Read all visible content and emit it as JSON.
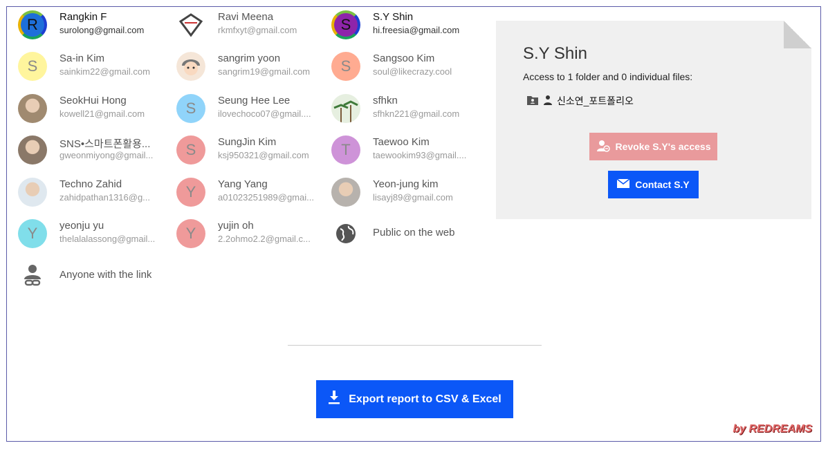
{
  "people": [
    {
      "name": "Rangkin F",
      "email": "surolong@gmail.com",
      "initial": "R",
      "avatar_bg": "#1e6fd9",
      "avatar_fg": "#111",
      "selected": true,
      "col": 0,
      "row": 0
    },
    {
      "name": "Ravi Meena",
      "email": "rkmfxyt@gmail.com",
      "initial": "",
      "avatar_bg": "#ffffff",
      "selected": false,
      "col": 1,
      "row": 0,
      "icon": "ravi-logo-icon"
    },
    {
      "name": "S.Y Shin",
      "email": "hi.freesia@gmail.com",
      "initial": "S",
      "avatar_bg": "#8e24aa",
      "avatar_fg": "#111",
      "selected": true,
      "col": 2,
      "row": 0
    },
    {
      "name": "Sa-in Kim",
      "email": "sainkim22@gmail.com",
      "initial": "S",
      "avatar_bg": "#fff59d",
      "selected": false,
      "col": 0,
      "row": 1
    },
    {
      "name": "sangrim yoon",
      "email": "sangrim19@gmail.com",
      "initial": "",
      "avatar_bg": "#f5e6d8",
      "selected": false,
      "col": 1,
      "row": 1,
      "icon": "cartoon-avatar-icon"
    },
    {
      "name": "Sangsoo Kim",
      "email": "soul@likecrazy.cool",
      "initial": "S",
      "avatar_bg": "#ffab91",
      "selected": false,
      "col": 2,
      "row": 1
    },
    {
      "name": "SeokHui Hong",
      "email": "kowell21@gmail.com",
      "initial": "",
      "avatar_bg": "#a08a70",
      "selected": false,
      "col": 0,
      "row": 2,
      "icon": "photo-avatar-icon"
    },
    {
      "name": "Seung Hee Lee",
      "email": "ilovechoco07@gmail....",
      "initial": "S",
      "avatar_bg": "#90d4fa",
      "selected": false,
      "col": 1,
      "row": 2
    },
    {
      "name": "sfhkn",
      "email": "sfhkn221@gmail.com",
      "initial": "",
      "avatar_bg": "#cfe3c4",
      "selected": false,
      "col": 2,
      "row": 2,
      "icon": "palm-photo-icon"
    },
    {
      "name": "SNS•스마트폰활용...",
      "email": "gweonmiyong@gmail...",
      "initial": "",
      "avatar_bg": "#8a7868",
      "selected": false,
      "col": 0,
      "row": 3,
      "icon": "photo-avatar-icon"
    },
    {
      "name": "SungJin Kim",
      "email": "ksj950321@gmail.com",
      "initial": "S",
      "avatar_bg": "#ef9a9a",
      "selected": false,
      "col": 1,
      "row": 3
    },
    {
      "name": "Taewoo Kim",
      "email": "taewookim93@gmail....",
      "initial": "T",
      "avatar_bg": "#ce93d8",
      "selected": false,
      "col": 2,
      "row": 3
    },
    {
      "name": "Techno Zahid",
      "email": "zahidpathan1316@g...",
      "initial": "",
      "avatar_bg": "#dfe8ef",
      "selected": false,
      "col": 0,
      "row": 4,
      "icon": "photo-avatar-icon"
    },
    {
      "name": "Yang Yang",
      "email": "a01023251989@gmai...",
      "initial": "Y",
      "avatar_bg": "#ef9a9a",
      "selected": false,
      "col": 1,
      "row": 4
    },
    {
      "name": "Yeon-jung kim",
      "email": "lisayj89@gmail.com",
      "initial": "",
      "avatar_bg": "#b7b2ad",
      "selected": false,
      "col": 2,
      "row": 4,
      "icon": "photo-avatar-icon"
    },
    {
      "name": "yeonju yu",
      "email": "thelalalassong@gmail...",
      "initial": "Y",
      "avatar_bg": "#80deea",
      "selected": false,
      "col": 0,
      "row": 5
    },
    {
      "name": "yujin oh",
      "email": "2.2ohmo2.2@gmail.c...",
      "initial": "Y",
      "avatar_bg": "#ef9a9a",
      "selected": false,
      "col": 1,
      "row": 5
    },
    {
      "name": "Public on the web",
      "email": "",
      "initial": "",
      "avatar_bg": "transparent",
      "selected": false,
      "col": 2,
      "row": 5,
      "icon": "globe-icon"
    },
    {
      "name": "Anyone with the link",
      "email": "",
      "initial": "",
      "avatar_bg": "transparent",
      "selected": false,
      "col": 0,
      "row": 6,
      "icon": "person-link-icon"
    }
  ],
  "panel": {
    "title": "S.Y Shin",
    "access": "Access to 1 folder and 0 individual files:",
    "file_name": "신소연_포트폴리오",
    "revoke_label": "Revoke S.Y's access",
    "contact_label": "Contact S.Y"
  },
  "export_label": "Export report to CSV & Excel",
  "watermark": "by REDREAMS",
  "colors": {
    "primary": "#0b57f7",
    "revoke": "#e99a9c",
    "panel_bg": "#f0f0f0"
  }
}
